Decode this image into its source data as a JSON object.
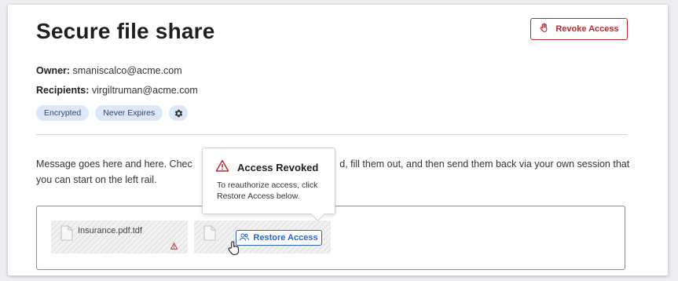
{
  "page": {
    "title": "Secure file share"
  },
  "actions": {
    "revoke_label": "Revoke Access"
  },
  "meta": {
    "owner_label": "Owner:",
    "owner_value": "smaniscalco@acme.com",
    "recipients_label": "Recipients:",
    "recipients_value": "virgiltruman@acme.com"
  },
  "tags": [
    "Encrypted",
    "Never Expires"
  ],
  "message": "Message goes here and here. Chec               d, fill them out, and then send them back via your own session that you can start on the left rail.",
  "files": [
    {
      "name": "Insurance.pdf.tdf"
    },
    {
      "name": ""
    }
  ],
  "restore": {
    "label": "Restore Access"
  },
  "popover": {
    "title": "Access Revoked",
    "body": "To reauthorize access, click Restore Access below."
  },
  "colors": {
    "danger": "#b9282d",
    "primary": "#2a64c5",
    "tag_bg": "#dce8f7"
  },
  "icons": {
    "revoke": "hand-stop-icon",
    "settings": "gear-icon",
    "warning": "warning-triangle-icon",
    "file": "document-icon",
    "restore": "users-icon",
    "cursor": "hand-pointer-icon"
  }
}
